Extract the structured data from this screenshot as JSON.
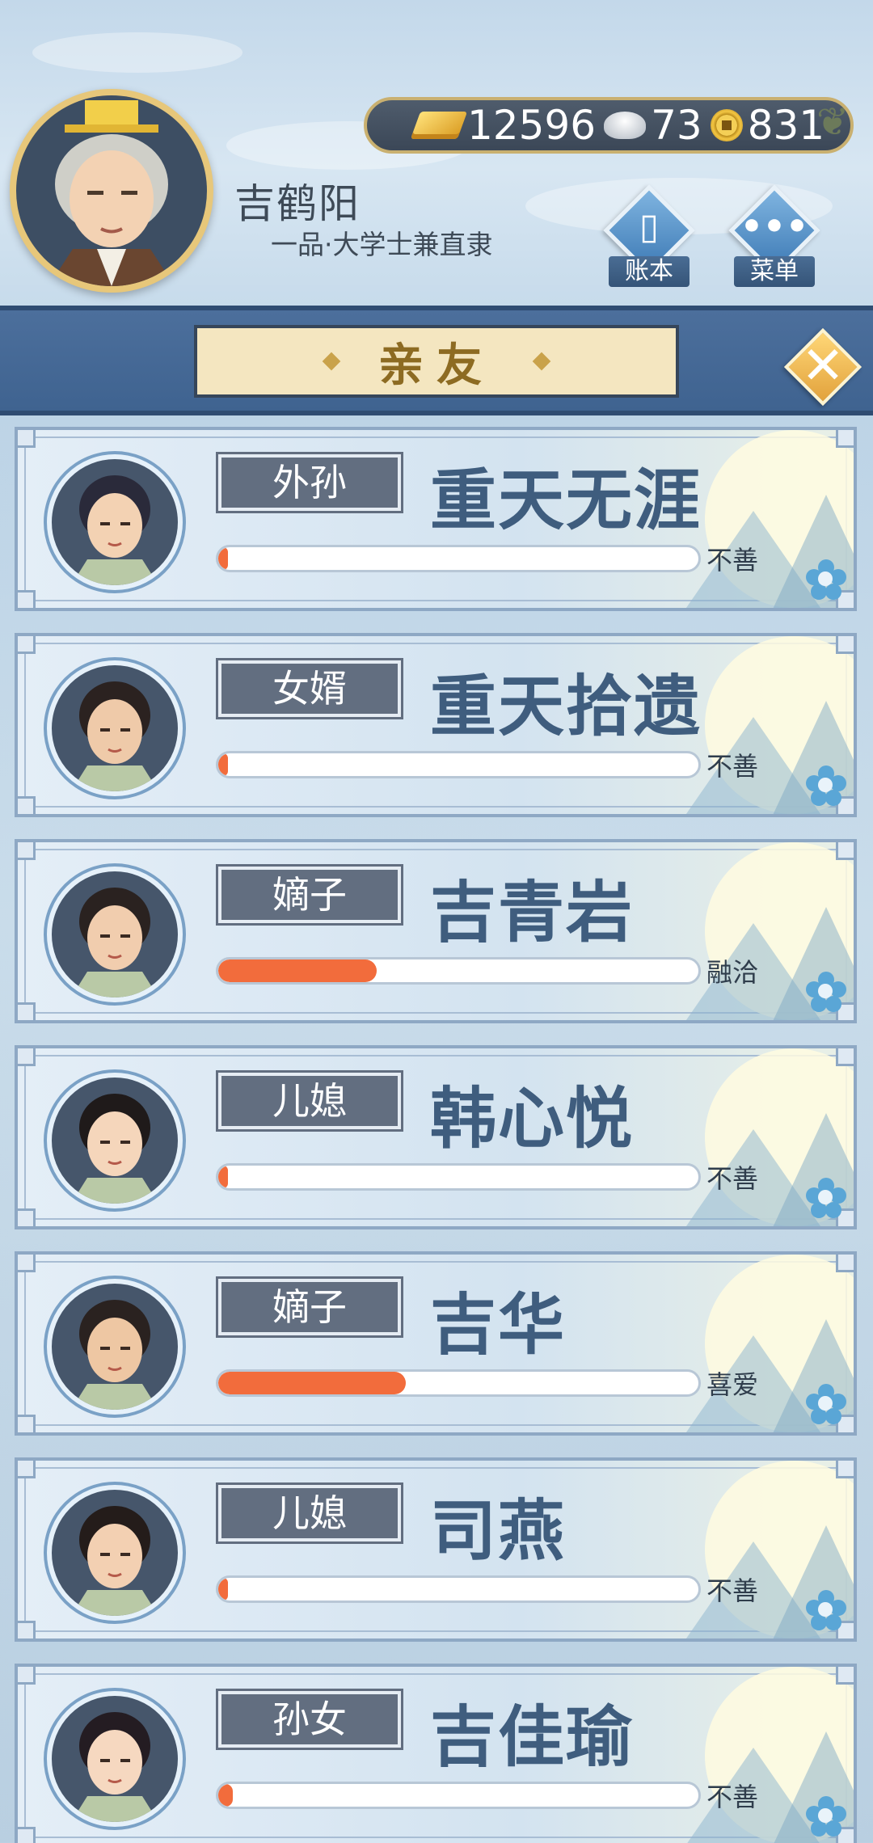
{
  "player": {
    "name": "吉鹤阳",
    "title": "一品·大学士兼直隶"
  },
  "currency": {
    "gold": "12596",
    "silver": "73",
    "coins": "831"
  },
  "buttons": {
    "ledger": "账本",
    "menu": "菜单"
  },
  "panel": {
    "title": "亲友",
    "close_glyph": "✕"
  },
  "relatives": [
    {
      "relation": "外孙",
      "name": "重天无涯",
      "favor": 0.01,
      "mood": "不善"
    },
    {
      "relation": "女婿",
      "name": "重天拾遗",
      "favor": 0.01,
      "mood": "不善"
    },
    {
      "relation": "嫡子",
      "name": "吉青岩",
      "favor": 0.33,
      "mood": "融洽"
    },
    {
      "relation": "儿媳",
      "name": "韩心悦",
      "favor": 0.01,
      "mood": "不善"
    },
    {
      "relation": "嫡子",
      "name": "吉华",
      "favor": 0.39,
      "mood": "喜爱"
    },
    {
      "relation": "儿媳",
      "name": "司燕",
      "favor": 0.01,
      "mood": "不善"
    },
    {
      "relation": "孙女",
      "name": "吉佳瑜",
      "favor": 0.03,
      "mood": "不善"
    }
  ],
  "colors": {
    "favor_fill": "#f26c3c",
    "panel_blue": "#4c6f9c",
    "tag_bg": "#626e80",
    "name_text": "#3f5d7e"
  },
  "icons": {
    "gold": "gold-ingot-icon",
    "silver": "silver-ingot-icon",
    "coin": "copper-coin-icon",
    "ledger": "ledger-book-icon",
    "menu": "more-dots-icon",
    "close": "close-icon"
  }
}
